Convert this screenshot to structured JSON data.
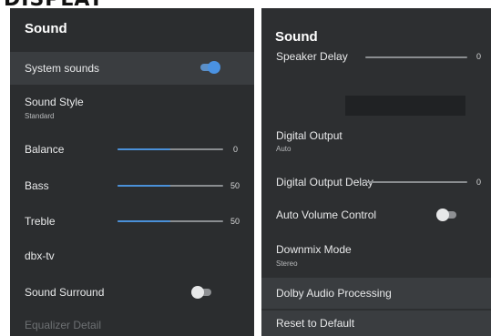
{
  "cropped_heading": "DISPLAY",
  "left": {
    "title": "Sound",
    "items": [
      {
        "label": "System sounds",
        "toggle": "on"
      },
      {
        "label": "Sound Style",
        "sub": "Standard"
      },
      {
        "label": "Balance",
        "value": "0",
        "level": 0.5
      },
      {
        "label": "Bass",
        "value": "50",
        "level": 0.5
      },
      {
        "label": "Treble",
        "value": "50",
        "level": 0.5
      },
      {
        "label": "dbx-tv"
      },
      {
        "label": "Sound Surround",
        "toggle": "off"
      },
      {
        "label": "Equalizer Detail"
      }
    ]
  },
  "right": {
    "title": "Sound",
    "items": [
      {
        "label": "Speaker Delay",
        "value": "0",
        "level": 0
      },
      {
        "label": "Digital Output",
        "sub": "Auto"
      },
      {
        "label": "Digital Output Delay",
        "value": "0",
        "level": 0
      },
      {
        "label": "Auto Volume Control",
        "toggle": "off"
      },
      {
        "label": "Downmix Mode",
        "sub": "Stereo"
      },
      {
        "label": "Dolby Audio Processing"
      },
      {
        "label": "Reset to Default"
      }
    ]
  },
  "colors": {
    "panel_bg": "#2b2d2f",
    "highlight": "#3a3d40",
    "accent": "#4a90d9"
  }
}
